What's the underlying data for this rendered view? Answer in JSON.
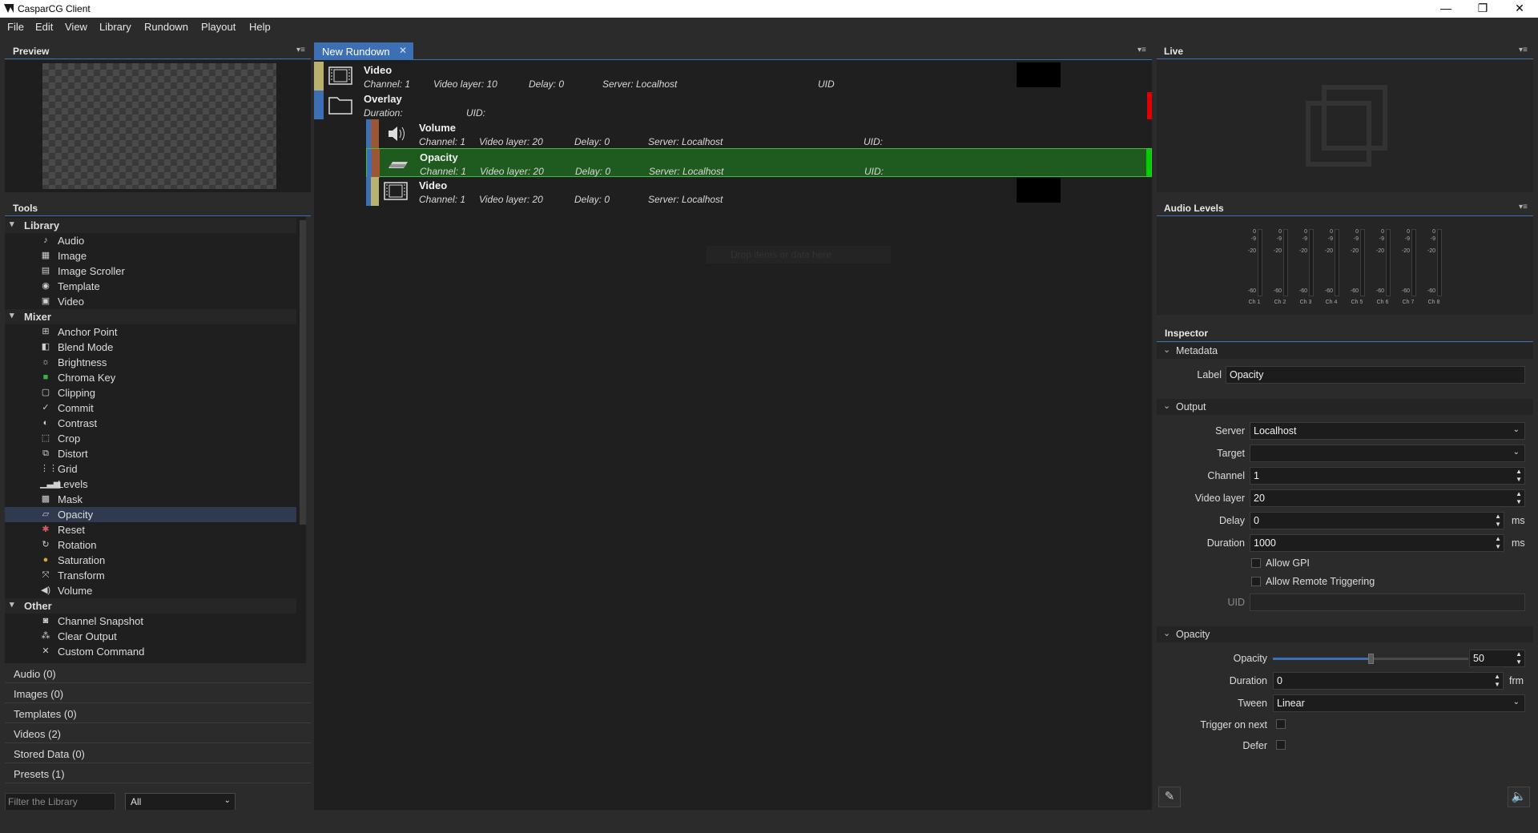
{
  "window": {
    "title": "CasparCG Client",
    "minimize": "—",
    "maximize": "❐",
    "close": "✕"
  },
  "menu": [
    "File",
    "Edit",
    "View",
    "Library",
    "Rundown",
    "Playout",
    "Help"
  ],
  "panels": {
    "preview": "Preview",
    "tools": "Tools",
    "live": "Live",
    "audio_levels": "Audio Levels",
    "inspector": "Inspector"
  },
  "tools": {
    "library": {
      "label": "Library",
      "items": [
        "Audio",
        "Image",
        "Image Scroller",
        "Template",
        "Video"
      ]
    },
    "mixer": {
      "label": "Mixer",
      "items": [
        "Anchor Point",
        "Blend Mode",
        "Brightness",
        "Chroma Key",
        "Clipping",
        "Commit",
        "Contrast",
        "Crop",
        "Distort",
        "Grid",
        "Levels",
        "Mask",
        "Opacity",
        "Reset",
        "Rotation",
        "Saturation",
        "Transform",
        "Volume"
      ]
    },
    "other": {
      "label": "Other",
      "items": [
        "Channel Snapshot",
        "Clear Output",
        "Custom Command"
      ]
    },
    "selected": "Opacity"
  },
  "library_sections": [
    "Audio (0)",
    "Images (0)",
    "Templates (0)",
    "Videos (2)",
    "Stored Data (0)",
    "Presets (1)"
  ],
  "filter": {
    "placeholder": "Filter the Library",
    "type_value": "All"
  },
  "rundown": {
    "tab": "New Rundown",
    "ghost_text": "Drop items or data here",
    "items": [
      {
        "name": "Video",
        "channel": "Channel: 1",
        "layer": "Video layer: 10",
        "delay": "Delay: 0",
        "server": "Server: Localhost",
        "uid": "UID",
        "color": "#b9b170"
      },
      {
        "name": "Overlay",
        "channel": "Duration:",
        "uid": "UID:",
        "color": "#3d6fb5"
      },
      {
        "name": "Volume",
        "channel": "Channel: 1",
        "layer": "Video layer: 20",
        "delay": "Delay: 0",
        "server": "Server: Localhost",
        "uid": "UID:",
        "color": "#9c5636"
      },
      {
        "name": "Opacity",
        "channel": "Channel: 1",
        "layer": "Video layer: 20",
        "delay": "Delay: 0",
        "server": "Server: Localhost",
        "uid": "UID:",
        "color": "#9c5636"
      },
      {
        "name": "Video",
        "channel": "Channel: 1",
        "layer": "Video layer: 20",
        "delay": "Delay: 0",
        "server": "Server: Localhost",
        "color": "#b9b170"
      }
    ]
  },
  "audio_meters": {
    "ticks": [
      "0",
      "-9",
      "-20",
      "-60"
    ],
    "channels": [
      "Ch 1",
      "Ch 2",
      "Ch 3",
      "Ch 4",
      "Ch 5",
      "Ch 6",
      "Ch 7",
      "Ch 8"
    ]
  },
  "inspector": {
    "metadata": {
      "header": "Metadata",
      "label_caption": "Label",
      "label_value": "Opacity"
    },
    "output": {
      "header": "Output",
      "server_caption": "Server",
      "server_value": "Localhost",
      "target_caption": "Target",
      "target_value": "",
      "channel_caption": "Channel",
      "channel_value": "1",
      "layer_caption": "Video layer",
      "layer_value": "20",
      "delay_caption": "Delay",
      "delay_value": "0",
      "delay_unit": "ms",
      "duration_caption": "Duration",
      "duration_value": "1000",
      "duration_unit": "ms",
      "allow_gpi": "Allow GPI",
      "allow_remote": "Allow Remote Triggering",
      "uid_caption": "UID",
      "uid_value": ""
    },
    "opacity": {
      "header": "Opacity",
      "opacity_caption": "Opacity",
      "opacity_value": "50",
      "opacity_fraction": 0.5,
      "duration_caption": "Duration",
      "duration_value": "0",
      "duration_unit": "frm",
      "tween_caption": "Tween",
      "tween_value": "Linear",
      "trigger_caption": "Trigger on next",
      "defer_caption": "Defer"
    }
  },
  "colors": {
    "accent": "#3d6fb5",
    "selected_row": "#1f5a1f",
    "active_marker": "#00d000",
    "stop_marker": "#e00000"
  }
}
